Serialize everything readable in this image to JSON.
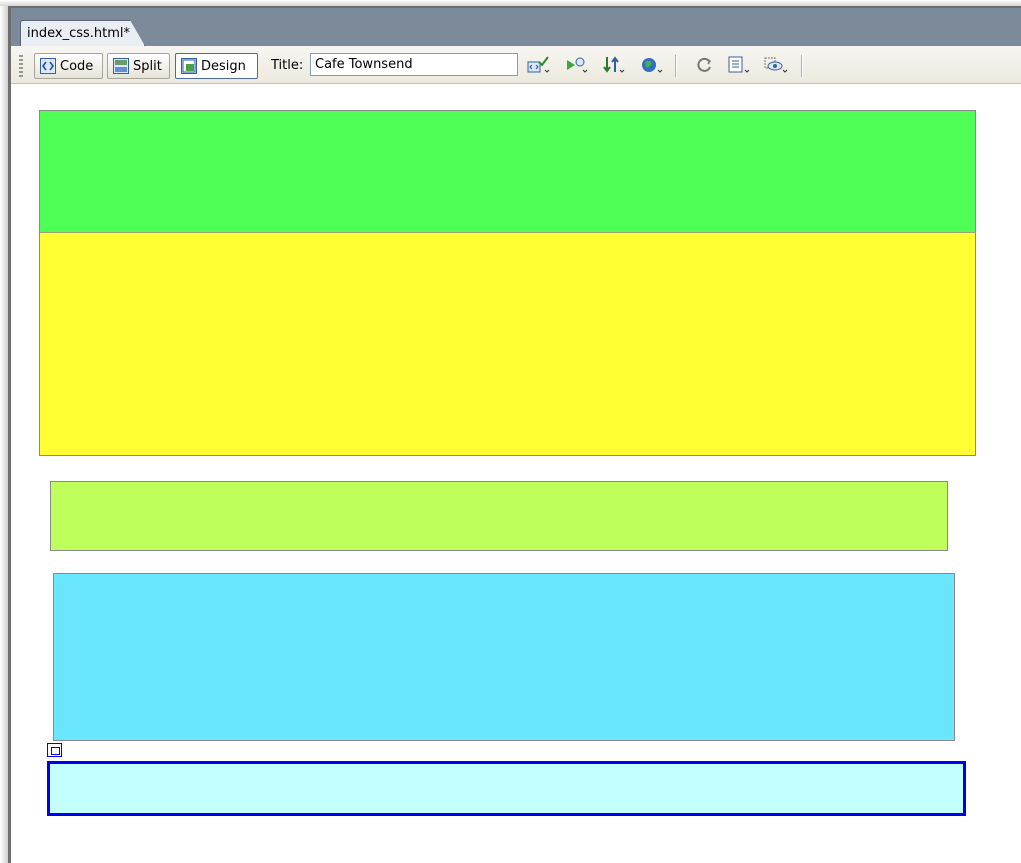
{
  "document_tab": {
    "label": "index_css.html*"
  },
  "toolbar": {
    "views": [
      {
        "label": "Code"
      },
      {
        "label": "Split"
      },
      {
        "label": "Design"
      }
    ],
    "title_label": "Title:",
    "title_value": "Cafe Townsend",
    "icons": [
      "validate-markup-icon",
      "browser-check-icon",
      "file-management-icon",
      "preview-browser-icon",
      "refresh-icon",
      "view-options-icon",
      "visual-aids-icon"
    ]
  },
  "canvas": {
    "blocks": [
      {
        "name": "green-block",
        "color": "#4fff55"
      },
      {
        "name": "yellow-block",
        "color": "#ffff33"
      },
      {
        "name": "lime-block",
        "color": "#bfff5c"
      },
      {
        "name": "cyan-block",
        "color": "#6ae6ff"
      },
      {
        "name": "selected-block",
        "color": "#c4ffff",
        "selected": true
      }
    ],
    "selection_color": "#0000ee"
  }
}
